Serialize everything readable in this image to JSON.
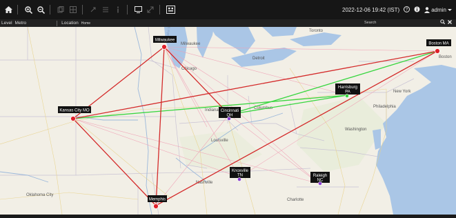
{
  "toolbar": {
    "datetime": "2022-12-06 19:42 (IST)",
    "user": "admin",
    "icons": [
      "home-icon",
      "zoom-in-icon",
      "zoom-out-icon",
      "copy-icon",
      "grid-icon",
      "pin-icon",
      "list-icon",
      "info-icon",
      "monitor-icon",
      "expand-icon",
      "image-icon"
    ]
  },
  "subbar": {
    "level_label": "Level",
    "level_value": "Metro",
    "location_label": "Location",
    "location_value": "Home",
    "search_label": "Search"
  },
  "map": {
    "place_names": {
      "milwaukee": "Milwaukee",
      "chicago": "Chicago",
      "detroit": "Detroit",
      "toronto": "Toronto",
      "indianapolis": "Indianapolis",
      "columbus": "Columbus",
      "louisville": "Louisville",
      "nashville": "Nashville",
      "charlotte": "Charlotte",
      "washington": "Washington",
      "philadelphia": "Philadelphia",
      "new_york": "New York",
      "boston": "Boston",
      "oklahoma_city": "Oklahoma City"
    },
    "water_names": {
      "lake_michigan": "Lake Michigan"
    },
    "sites": [
      {
        "key": "milwaukee",
        "label": "Milwaukee",
        "status": "red"
      },
      {
        "key": "boston",
        "label": "Boston MA",
        "status": "red"
      },
      {
        "key": "kansas",
        "label": "Kansas City MO",
        "status": "red"
      },
      {
        "key": "harrisburg",
        "label": "Harrisburg PA",
        "status": "green"
      },
      {
        "key": "cincinnati",
        "label": "Cincinnati OH",
        "status": "purple"
      },
      {
        "key": "knoxville",
        "label": "Knoxville TN",
        "status": "purple"
      },
      {
        "key": "raleigh",
        "label": "Raleigh NC",
        "status": "purple"
      },
      {
        "key": "memphis",
        "label": "Memphis",
        "status": "red"
      }
    ],
    "link_colors": {
      "down": "#d42a2a",
      "up": "#36d63e",
      "minor": "#f0a0b4"
    }
  }
}
